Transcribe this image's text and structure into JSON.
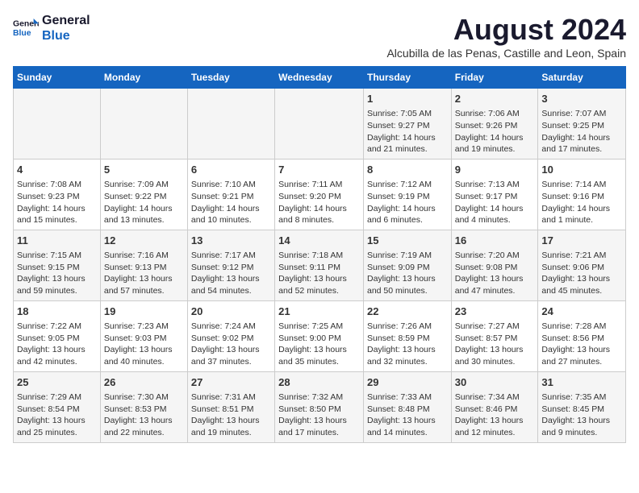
{
  "logo": {
    "line1": "General",
    "line2": "Blue"
  },
  "title": "August 2024",
  "subtitle": "Alcubilla de las Penas, Castille and Leon, Spain",
  "days_of_week": [
    "Sunday",
    "Monday",
    "Tuesday",
    "Wednesday",
    "Thursday",
    "Friday",
    "Saturday"
  ],
  "weeks": [
    [
      {
        "day": "",
        "content": ""
      },
      {
        "day": "",
        "content": ""
      },
      {
        "day": "",
        "content": ""
      },
      {
        "day": "",
        "content": ""
      },
      {
        "day": "1",
        "content": "Sunrise: 7:05 AM\nSunset: 9:27 PM\nDaylight: 14 hours\nand 21 minutes."
      },
      {
        "day": "2",
        "content": "Sunrise: 7:06 AM\nSunset: 9:26 PM\nDaylight: 14 hours\nand 19 minutes."
      },
      {
        "day": "3",
        "content": "Sunrise: 7:07 AM\nSunset: 9:25 PM\nDaylight: 14 hours\nand 17 minutes."
      }
    ],
    [
      {
        "day": "4",
        "content": "Sunrise: 7:08 AM\nSunset: 9:23 PM\nDaylight: 14 hours\nand 15 minutes."
      },
      {
        "day": "5",
        "content": "Sunrise: 7:09 AM\nSunset: 9:22 PM\nDaylight: 14 hours\nand 13 minutes."
      },
      {
        "day": "6",
        "content": "Sunrise: 7:10 AM\nSunset: 9:21 PM\nDaylight: 14 hours\nand 10 minutes."
      },
      {
        "day": "7",
        "content": "Sunrise: 7:11 AM\nSunset: 9:20 PM\nDaylight: 14 hours\nand 8 minutes."
      },
      {
        "day": "8",
        "content": "Sunrise: 7:12 AM\nSunset: 9:19 PM\nDaylight: 14 hours\nand 6 minutes."
      },
      {
        "day": "9",
        "content": "Sunrise: 7:13 AM\nSunset: 9:17 PM\nDaylight: 14 hours\nand 4 minutes."
      },
      {
        "day": "10",
        "content": "Sunrise: 7:14 AM\nSunset: 9:16 PM\nDaylight: 14 hours\nand 1 minute."
      }
    ],
    [
      {
        "day": "11",
        "content": "Sunrise: 7:15 AM\nSunset: 9:15 PM\nDaylight: 13 hours\nand 59 minutes."
      },
      {
        "day": "12",
        "content": "Sunrise: 7:16 AM\nSunset: 9:13 PM\nDaylight: 13 hours\nand 57 minutes."
      },
      {
        "day": "13",
        "content": "Sunrise: 7:17 AM\nSunset: 9:12 PM\nDaylight: 13 hours\nand 54 minutes."
      },
      {
        "day": "14",
        "content": "Sunrise: 7:18 AM\nSunset: 9:11 PM\nDaylight: 13 hours\nand 52 minutes."
      },
      {
        "day": "15",
        "content": "Sunrise: 7:19 AM\nSunset: 9:09 PM\nDaylight: 13 hours\nand 50 minutes."
      },
      {
        "day": "16",
        "content": "Sunrise: 7:20 AM\nSunset: 9:08 PM\nDaylight: 13 hours\nand 47 minutes."
      },
      {
        "day": "17",
        "content": "Sunrise: 7:21 AM\nSunset: 9:06 PM\nDaylight: 13 hours\nand 45 minutes."
      }
    ],
    [
      {
        "day": "18",
        "content": "Sunrise: 7:22 AM\nSunset: 9:05 PM\nDaylight: 13 hours\nand 42 minutes."
      },
      {
        "day": "19",
        "content": "Sunrise: 7:23 AM\nSunset: 9:03 PM\nDaylight: 13 hours\nand 40 minutes."
      },
      {
        "day": "20",
        "content": "Sunrise: 7:24 AM\nSunset: 9:02 PM\nDaylight: 13 hours\nand 37 minutes."
      },
      {
        "day": "21",
        "content": "Sunrise: 7:25 AM\nSunset: 9:00 PM\nDaylight: 13 hours\nand 35 minutes."
      },
      {
        "day": "22",
        "content": "Sunrise: 7:26 AM\nSunset: 8:59 PM\nDaylight: 13 hours\nand 32 minutes."
      },
      {
        "day": "23",
        "content": "Sunrise: 7:27 AM\nSunset: 8:57 PM\nDaylight: 13 hours\nand 30 minutes."
      },
      {
        "day": "24",
        "content": "Sunrise: 7:28 AM\nSunset: 8:56 PM\nDaylight: 13 hours\nand 27 minutes."
      }
    ],
    [
      {
        "day": "25",
        "content": "Sunrise: 7:29 AM\nSunset: 8:54 PM\nDaylight: 13 hours\nand 25 minutes."
      },
      {
        "day": "26",
        "content": "Sunrise: 7:30 AM\nSunset: 8:53 PM\nDaylight: 13 hours\nand 22 minutes."
      },
      {
        "day": "27",
        "content": "Sunrise: 7:31 AM\nSunset: 8:51 PM\nDaylight: 13 hours\nand 19 minutes."
      },
      {
        "day": "28",
        "content": "Sunrise: 7:32 AM\nSunset: 8:50 PM\nDaylight: 13 hours\nand 17 minutes."
      },
      {
        "day": "29",
        "content": "Sunrise: 7:33 AM\nSunset: 8:48 PM\nDaylight: 13 hours\nand 14 minutes."
      },
      {
        "day": "30",
        "content": "Sunrise: 7:34 AM\nSunset: 8:46 PM\nDaylight: 13 hours\nand 12 minutes."
      },
      {
        "day": "31",
        "content": "Sunrise: 7:35 AM\nSunset: 8:45 PM\nDaylight: 13 hours\nand 9 minutes."
      }
    ]
  ]
}
